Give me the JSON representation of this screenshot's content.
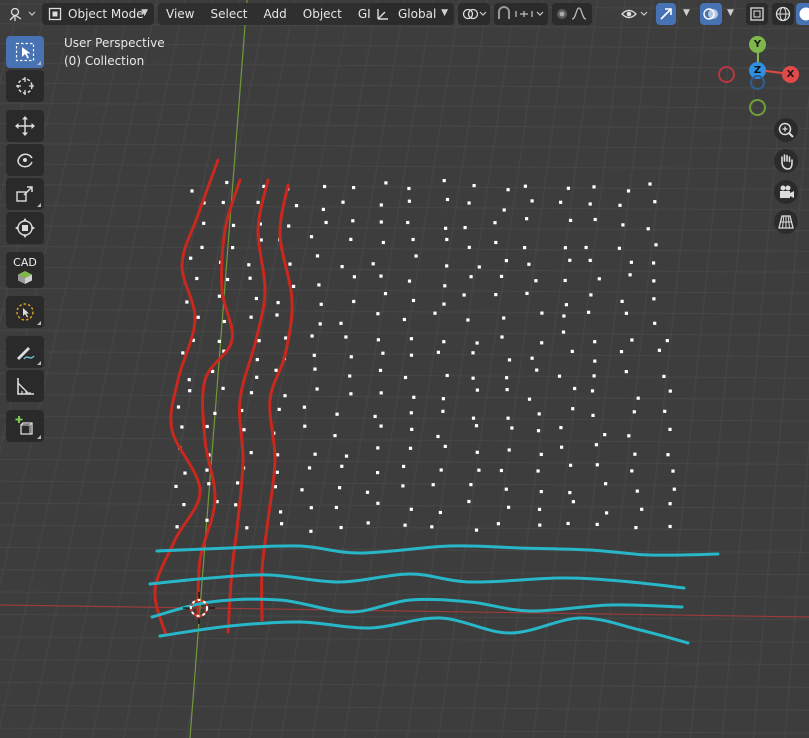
{
  "header": {
    "mode": "Object Mode",
    "menus": [
      "View",
      "Select",
      "Add",
      "Object",
      "GIS"
    ],
    "transform_orientation": "Global"
  },
  "viewport": {
    "view_name": "User Perspective",
    "collection": "(0) Collection"
  },
  "toolbar": {
    "cad_label": "CAD"
  },
  "gizmo": {
    "y_label": "Y",
    "z_label": "Z",
    "x_label": "X"
  },
  "colors": {
    "red_curves": "#c8281e",
    "cyan_curves": "#27b7c8",
    "axis_x": "#9b3b3b",
    "axis_y": "#6f9a3a",
    "active_tool": "#4772b3"
  }
}
